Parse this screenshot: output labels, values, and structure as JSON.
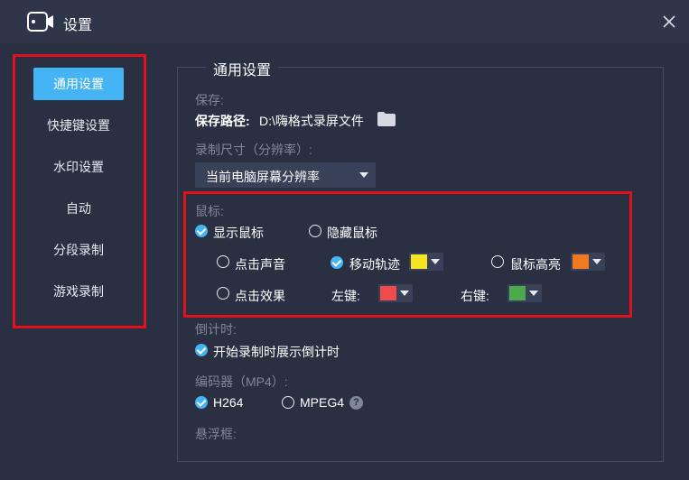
{
  "window": {
    "title": "设置"
  },
  "sidebar": {
    "items": [
      {
        "label": "通用设置",
        "active": true
      },
      {
        "label": "快捷键设置"
      },
      {
        "label": "水印设置"
      },
      {
        "label": "自动"
      },
      {
        "label": "分段录制"
      },
      {
        "label": "游戏录制"
      }
    ]
  },
  "general": {
    "section_title": "通用设置",
    "save": {
      "label": "保存:",
      "path_label": "保存路径:",
      "path_value": "D:\\嗨格式录屏文件"
    },
    "resolution": {
      "label": "录制尺寸（分辨率）:",
      "selected": "当前电脑屏幕分辨率"
    },
    "mouse": {
      "label": "鼠标:",
      "show_label": "显示鼠标",
      "show_checked": true,
      "hide_label": "隐藏鼠标",
      "click_sound": "点击声音",
      "move_track": "移动轨迹",
      "move_track_checked": true,
      "move_track_color": "#f5e326",
      "highlight": "鼠标高亮",
      "highlight_color": "#f07a22",
      "click_effect": "点击效果",
      "left_key": "左键:",
      "left_color": "#f04a4a",
      "right_key": "右键:",
      "right_color": "#4caa4c"
    },
    "countdown": {
      "label": "倒计时:",
      "option": "开始录制时展示倒计时",
      "checked": true
    },
    "encoder": {
      "label": "编码器（MP4）:",
      "h264": "H264",
      "h264_checked": true,
      "mpeg4": "MPEG4",
      "help": "?"
    },
    "floating": {
      "label": "悬浮框:"
    }
  },
  "colors": {
    "accent": "#45b4f5",
    "highlight_border": "#e0101c",
    "background": "#2a3042"
  }
}
